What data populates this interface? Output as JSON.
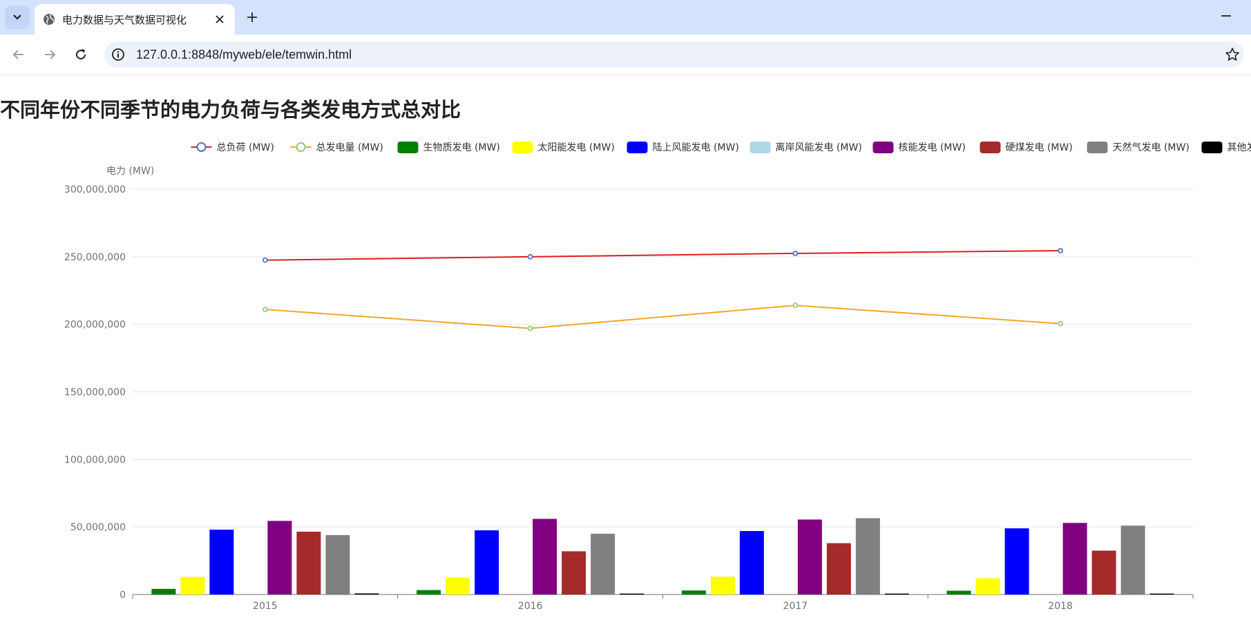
{
  "browser": {
    "tab_title": "电力数据与天气数据可视化",
    "url": "127.0.0.1:8848/myweb/ele/temwin.html"
  },
  "page": {
    "title": "不同年份不同季节的电力负荷与各类发电方式总对比"
  },
  "chart_data": {
    "type": "bar",
    "categories": [
      "2015",
      "2016",
      "2017",
      "2018"
    ],
    "ylabel": "电力 (MW)",
    "ylim": [
      0,
      300000000
    ],
    "yticks": [
      0,
      50000000,
      100000000,
      150000000,
      200000000,
      250000000,
      300000000
    ],
    "ytick_labels": [
      "0",
      "50,000,000",
      "100,000,000",
      "150,000,000",
      "200,000,000",
      "250,000,000",
      "300,000,000"
    ],
    "grid": true,
    "legend_position": "top",
    "series": [
      {
        "name": "总负荷 (MW)",
        "kind": "line",
        "color": "#e01e1e",
        "marker_color": "#5470c6",
        "values": [
          247500000,
          250000000,
          252500000,
          254500000
        ]
      },
      {
        "name": "总发电量 (MW)",
        "kind": "line",
        "color": "#f5a623",
        "marker_color": "#91cc75",
        "values": [
          211000000,
          197000000,
          214000000,
          200500000
        ]
      },
      {
        "name": "生物质发电 (MW)",
        "kind": "bar",
        "color": "#008000",
        "values": [
          4200000,
          3300000,
          3000000,
          2800000
        ]
      },
      {
        "name": "太阳能发电 (MW)",
        "kind": "bar",
        "color": "#ffff00",
        "values": [
          13000000,
          12500000,
          13200000,
          12000000
        ]
      },
      {
        "name": "陆上风能发电 (MW)",
        "kind": "bar",
        "color": "#0000ff",
        "values": [
          48000000,
          47500000,
          47000000,
          49000000
        ]
      },
      {
        "name": "离岸风能发电 (MW)",
        "kind": "bar",
        "color": "#add8e6",
        "values": [
          0,
          0,
          0,
          0
        ]
      },
      {
        "name": "核能发电 (MW)",
        "kind": "bar",
        "color": "#800080",
        "values": [
          54500000,
          56000000,
          55500000,
          53000000
        ]
      },
      {
        "name": "硬煤发电 (MW)",
        "kind": "bar",
        "color": "#a52a2a",
        "values": [
          46500000,
          32000000,
          38000000,
          32500000
        ]
      },
      {
        "name": "天然气发电 (MW)",
        "kind": "bar",
        "color": "#808080",
        "values": [
          44000000,
          45000000,
          56500000,
          51000000
        ]
      },
      {
        "name": "其他发电 (MW)",
        "kind": "bar",
        "color": "#000000",
        "values": [
          800000,
          700000,
          700000,
          700000
        ]
      }
    ]
  }
}
